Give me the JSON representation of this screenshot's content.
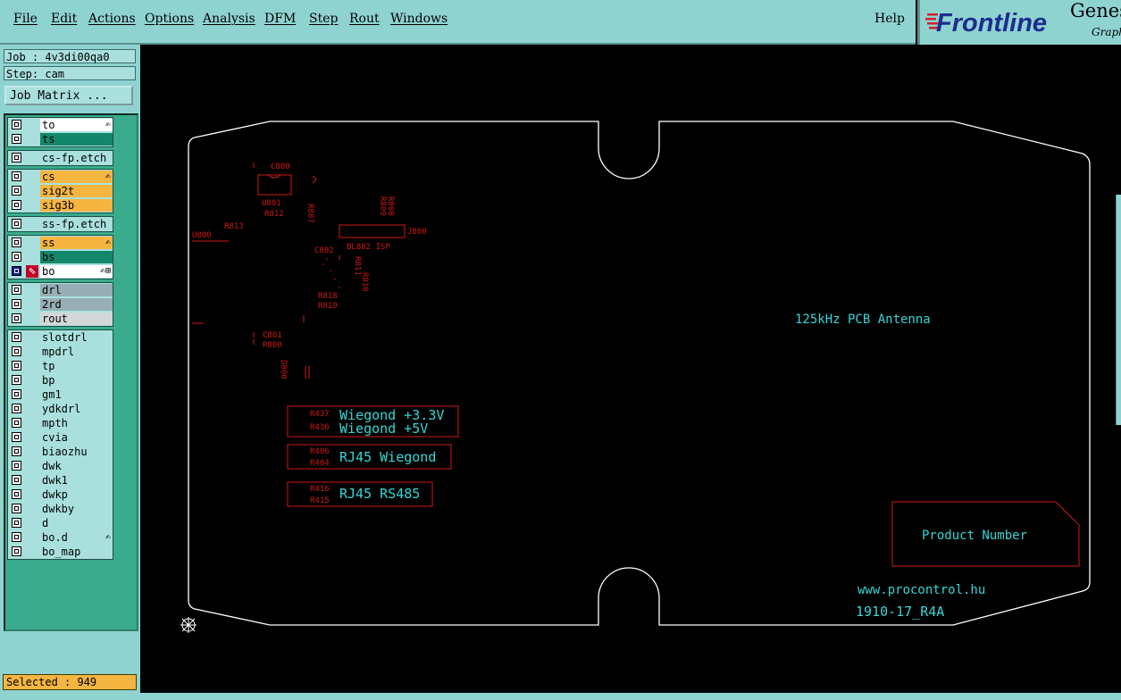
{
  "menu": [
    "File",
    "Edit",
    "Actions",
    "Options",
    "Analysis",
    "DFM",
    "Step",
    "Rout",
    "Windows",
    "Help"
  ],
  "brand": {
    "logo_text": "Frontline",
    "product": "Genesis",
    "sub": "Graphic"
  },
  "job": {
    "label": "Job : 4v3di00qa0"
  },
  "step": {
    "label": "Step: cam"
  },
  "job_matrix_label": "Job Matrix ...",
  "layer_groups": [
    [
      {
        "name": "to",
        "color": "white",
        "tag": "✍"
      },
      {
        "name": "ts",
        "color": "green"
      }
    ],
    [
      {
        "name": "cs-fp.etch",
        "color": "cyan"
      }
    ],
    [
      {
        "name": "cs",
        "color": "orange",
        "tag": "✍"
      },
      {
        "name": "sig2t",
        "color": "orange"
      },
      {
        "name": "sig3b",
        "color": "orange"
      }
    ],
    [
      {
        "name": "ss-fp.etch",
        "color": "cyan"
      }
    ],
    [
      {
        "name": "ss",
        "color": "orange",
        "tag": "✍"
      },
      {
        "name": "bs",
        "color": "green"
      },
      {
        "name": "bo",
        "color": "white",
        "tag": "✍⊞",
        "active": true
      }
    ],
    [
      {
        "name": "drl",
        "color": "grey"
      },
      {
        "name": "2rd",
        "color": "grey"
      },
      {
        "name": "rout",
        "color": "lgrey"
      }
    ],
    [
      {
        "name": "slotdrl",
        "color": "cyan"
      },
      {
        "name": "mpdrl",
        "color": "cyan"
      },
      {
        "name": "tp",
        "color": "cyan"
      },
      {
        "name": "bp",
        "color": "cyan"
      },
      {
        "name": "gm1",
        "color": "cyan"
      },
      {
        "name": "ydkdrl",
        "color": "cyan"
      },
      {
        "name": "mpth",
        "color": "cyan"
      },
      {
        "name": "cvia",
        "color": "cyan"
      },
      {
        "name": "biaozhu",
        "color": "cyan"
      },
      {
        "name": "dwk",
        "color": "cyan"
      },
      {
        "name": "dwk1",
        "color": "cyan"
      },
      {
        "name": "dwkp",
        "color": "cyan"
      },
      {
        "name": "dwkby",
        "color": "cyan"
      },
      {
        "name": "d",
        "color": "cyan"
      },
      {
        "name": "bo.d",
        "color": "cyan",
        "tag": "✍"
      },
      {
        "name": "bo_map",
        "color": "cyan"
      }
    ]
  ],
  "selected": "Selected : 949",
  "colors": {
    "panel": "#8fd3d1",
    "outline": "#ffffff",
    "silk_red": "#d01818",
    "silk_cyan": "#35d6d6",
    "canvas": "#000000"
  },
  "pcb": {
    "antenna_text": "125kHz PCB Antenna",
    "product_text": "Product Number",
    "url_text": "www.procontrol.hu",
    "code_text": "1910-17_R4A",
    "box1_line1": "Wiegond +3.3V",
    "box1_line2": "Wiegond +5V",
    "box1_refs": [
      "R437",
      "R436"
    ],
    "box2_text": "RJ45 Wiegond",
    "box2_refs": [
      "R406",
      "R404"
    ],
    "box3_text": "RJ45 RS485",
    "box3_refs": [
      "R416",
      "R415"
    ],
    "refdes": [
      "C800",
      "U801",
      "R812",
      "R813",
      "U800",
      "R807",
      "R808",
      "R809",
      "J800",
      "BL882 ISP",
      "C802",
      "R811",
      "R810",
      "R818",
      "R819",
      "C801",
      "R800",
      "D800"
    ]
  }
}
